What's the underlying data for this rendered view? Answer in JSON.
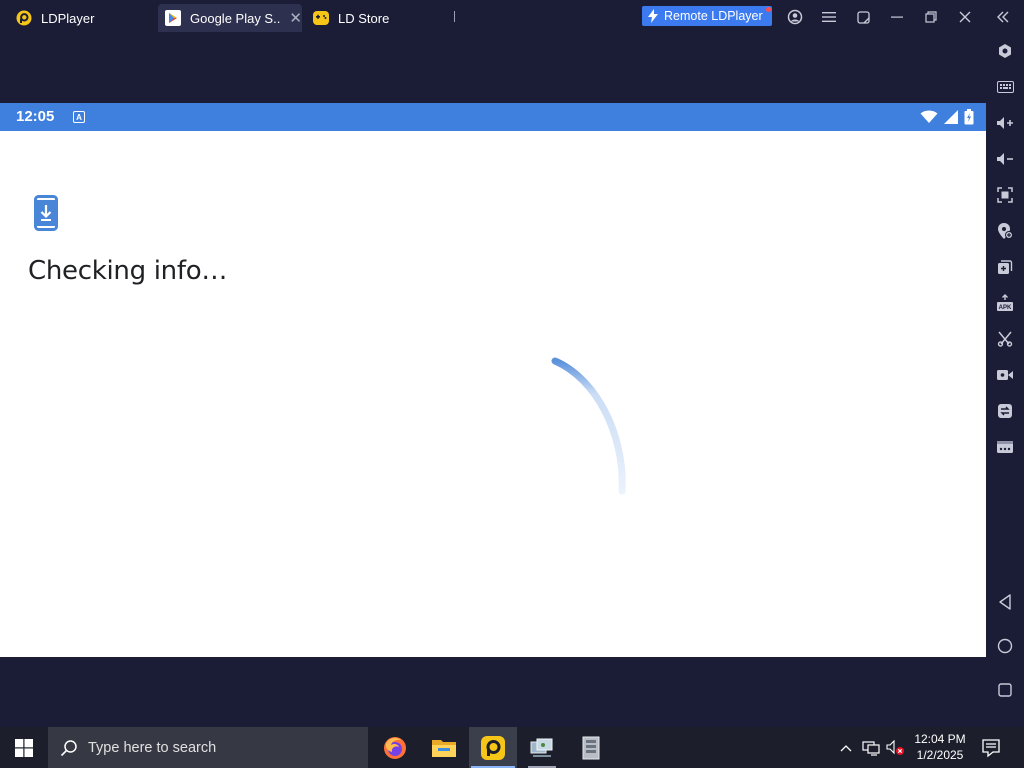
{
  "titlebar": {
    "tabs": [
      {
        "label": "LDPlayer",
        "icon": "ldplayer-logo-icon"
      },
      {
        "label": "Google Play S...",
        "icon": "google-play-icon"
      },
      {
        "label": "LD Store",
        "icon": "ld-store-icon"
      }
    ],
    "remote_button": "Remote LDPlayer",
    "window_icons": [
      "account-icon",
      "menu-icon",
      "resize-icon",
      "minimize-icon",
      "restore-icon",
      "close-icon",
      "collapse-toolbar-icon"
    ]
  },
  "toolbar": {
    "icons": [
      "settings-icon",
      "keyboard-icon",
      "volume-up-icon",
      "volume-down-icon",
      "screenshot-icon",
      "add-location-icon",
      "multi-instance-icon",
      "apk-install-icon",
      "scissors-icon",
      "record-video-icon",
      "sync-icon",
      "more-icon",
      "back-icon",
      "home-icon",
      "recents-icon"
    ]
  },
  "android": {
    "status_bar": {
      "time": "12:05",
      "notification": "A"
    },
    "heading": "Checking info…"
  },
  "taskbar": {
    "search_placeholder": "Type here to search",
    "apps": [
      "firefox-icon",
      "file-explorer-icon",
      "ldplayer-taskbar-icon",
      "network-app-icon",
      "archive-app-icon"
    ],
    "time": "12:04 PM",
    "date": "1/2/2025"
  },
  "colors": {
    "accent": "#3f7fde",
    "remote_button": "#3c7bef",
    "background": "#1b1d36",
    "ld_yellow": "#f5c518"
  }
}
